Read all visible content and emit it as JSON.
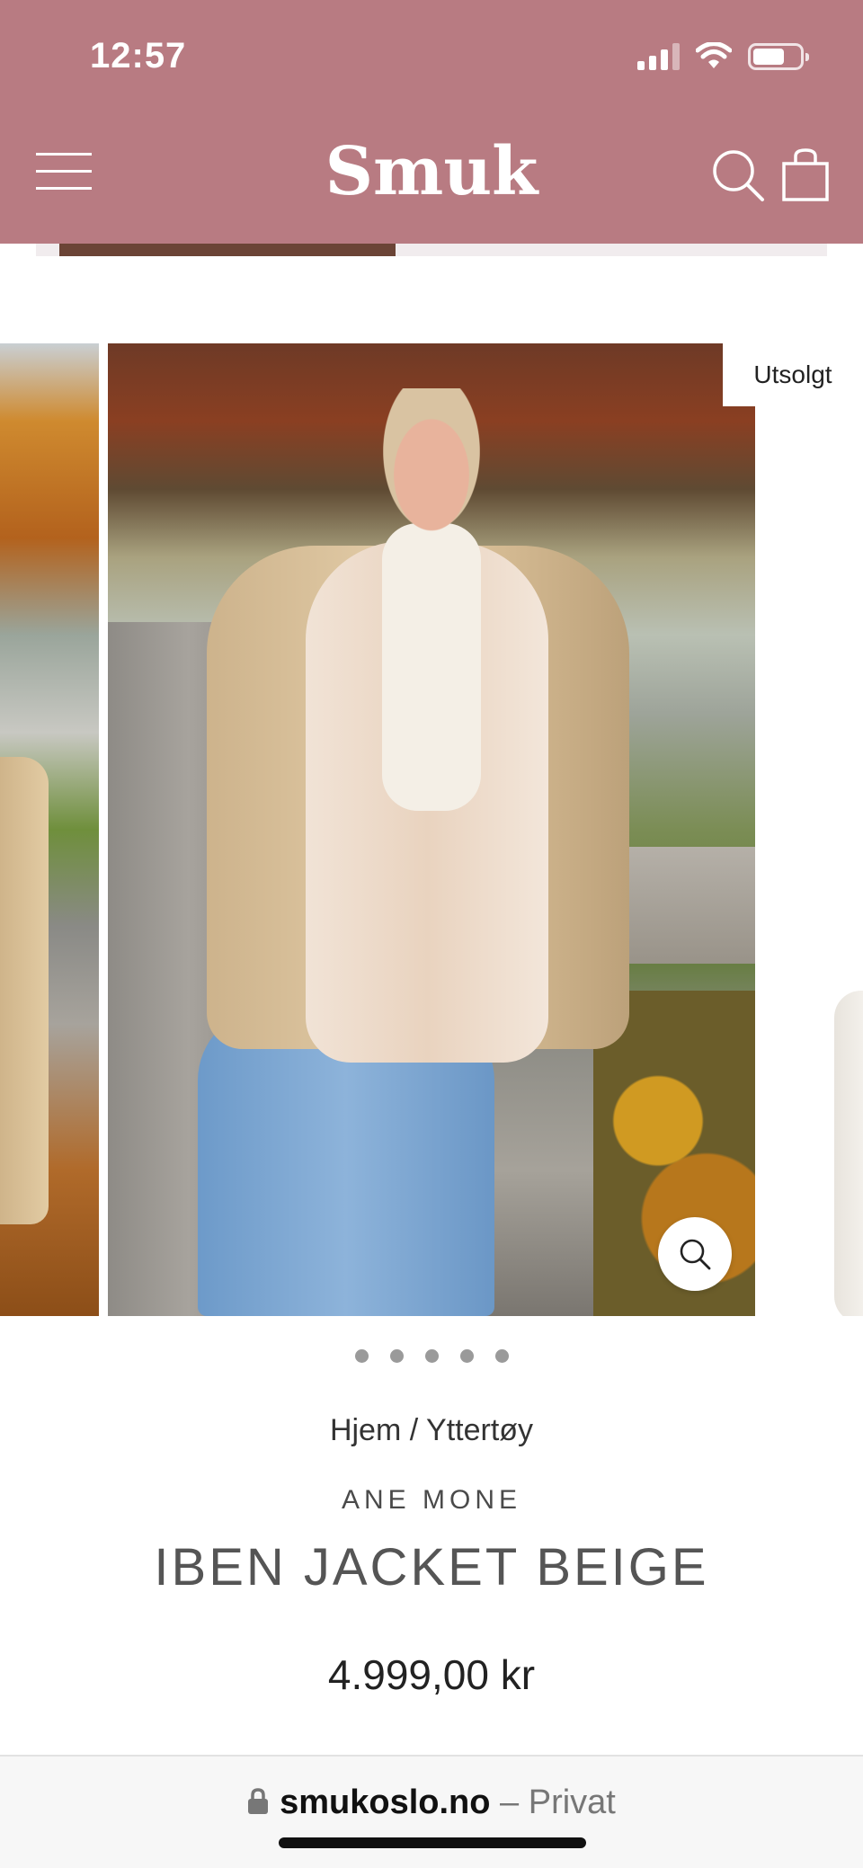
{
  "status_bar": {
    "time": "12:57",
    "icons": [
      "cellular-signal-icon",
      "wifi-icon",
      "battery-icon"
    ]
  },
  "header": {
    "logo": "Smuk",
    "background_color": "#b87b82",
    "icons": [
      "hamburger-menu-icon",
      "search-icon",
      "shopping-bag-icon"
    ]
  },
  "gallery": {
    "badge": "Utsolgt",
    "dot_count": 5,
    "zoom_icon": "magnifier-icon"
  },
  "product": {
    "breadcrumb_home": "Hjem",
    "breadcrumb_separator": " / ",
    "breadcrumb_category": "Yttertøy",
    "brand": "ANE MONE",
    "title": "IBEN JACKET BEIGE",
    "price": "4.999,00 kr"
  },
  "browser": {
    "domain": "smukoslo.no",
    "separator": " – ",
    "mode": "Privat",
    "lock_icon": "lock-icon"
  }
}
